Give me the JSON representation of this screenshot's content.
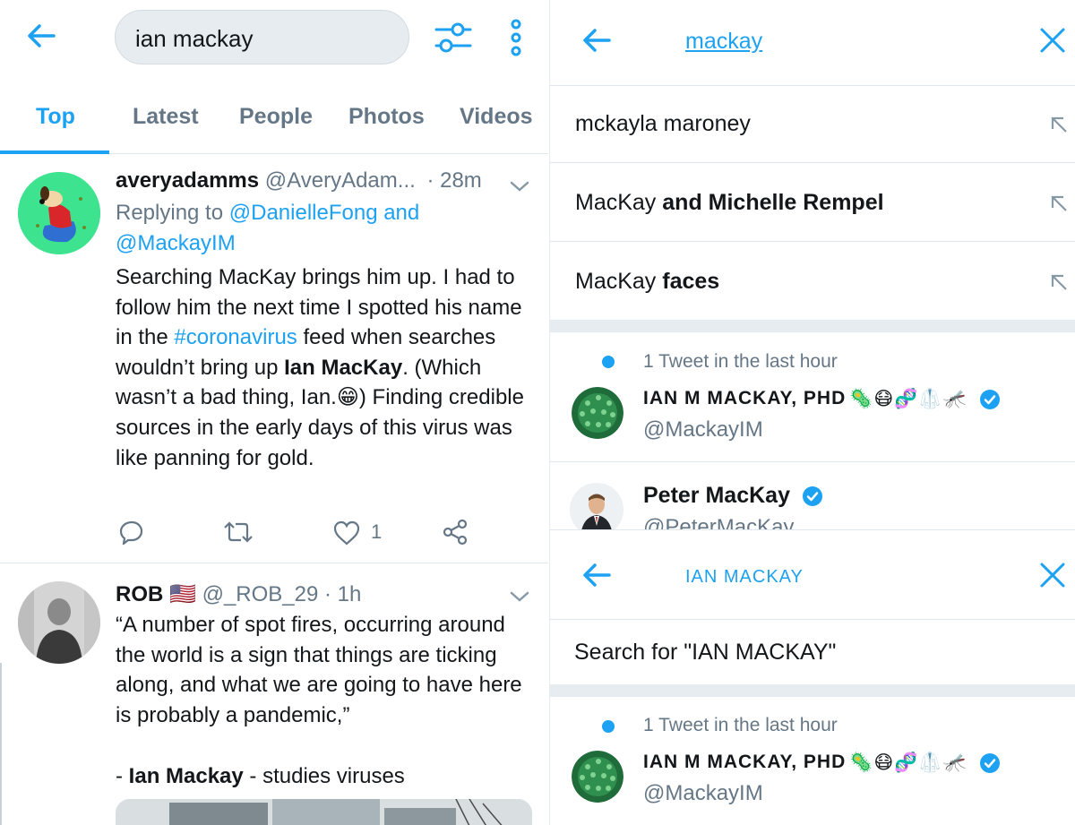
{
  "left": {
    "search": {
      "query": "ian mackay"
    },
    "tabs": [
      {
        "label": "Top",
        "active": true
      },
      {
        "label": "Latest",
        "active": false
      },
      {
        "label": "People",
        "active": false
      },
      {
        "label": "Photos",
        "active": false
      },
      {
        "label": "Videos",
        "active": false
      }
    ],
    "tweets": [
      {
        "display_name": "averyadamms",
        "handle": "@AveryAdam...",
        "time": "· 28m",
        "replying_prefix": "Replying to",
        "replying_to": "@DanielleFong and @MackayIM",
        "body_1": "Searching MacKay brings him up. I had to follow him the next time I spotted his name in the ",
        "hashtag": "#coronavirus",
        "body_2": " feed when searches wouldn’t bring up ",
        "body_bold": "Ian MacKay",
        "body_3": ". (Which wasn’t a bad thing, Ian.",
        "body_emoji": "😁",
        "body_4": ") Finding credible sources in the early days of this virus was like panning for gold.",
        "like_count": "1"
      },
      {
        "display_name": "ROB",
        "flag": "🇺🇸",
        "handle": "@_ROB_29",
        "time": "· 1h",
        "body": "“A number of spot fires, occurring around the world is a sign that things are ticking along, and what we are going to have here is probably a pandemic,”",
        "attribution_prefix": "- ",
        "attribution_bold": "Ian Mackay",
        "attribution_suffix": " - studies viruses"
      }
    ]
  },
  "right_top": {
    "query": "mackay",
    "suggestions": [
      {
        "plain": "mckayla maroney",
        "bold": ""
      },
      {
        "plain": "MacKay ",
        "bold": "and Michelle Rempel"
      },
      {
        "plain": "MacKay ",
        "bold": "faces"
      }
    ],
    "activity": "1 Tweet in the last hour",
    "users": [
      {
        "name": "IAN M MACKAY, PHD",
        "emojis": "🦠😷🧬🥼🦟",
        "handle": "@MackayIM",
        "verified": true
      },
      {
        "name": "Peter MacKay",
        "handle": "@PeterMacKay",
        "verified": true
      }
    ]
  },
  "right_bottom": {
    "query": "IAN MACKAY",
    "search_for": "Search for \"IAN MACKAY\"",
    "activity": "1 Tweet in the last hour",
    "user": {
      "name": "IAN M MACKAY, PHD",
      "emojis": "🦠😷🧬🥼🦟",
      "handle": "@MackayIM",
      "verified": true
    }
  },
  "colors": {
    "accent": "#1da1f2",
    "secondary_text": "#657786",
    "divider": "#e1e8ed",
    "band": "#e6ecf0"
  }
}
